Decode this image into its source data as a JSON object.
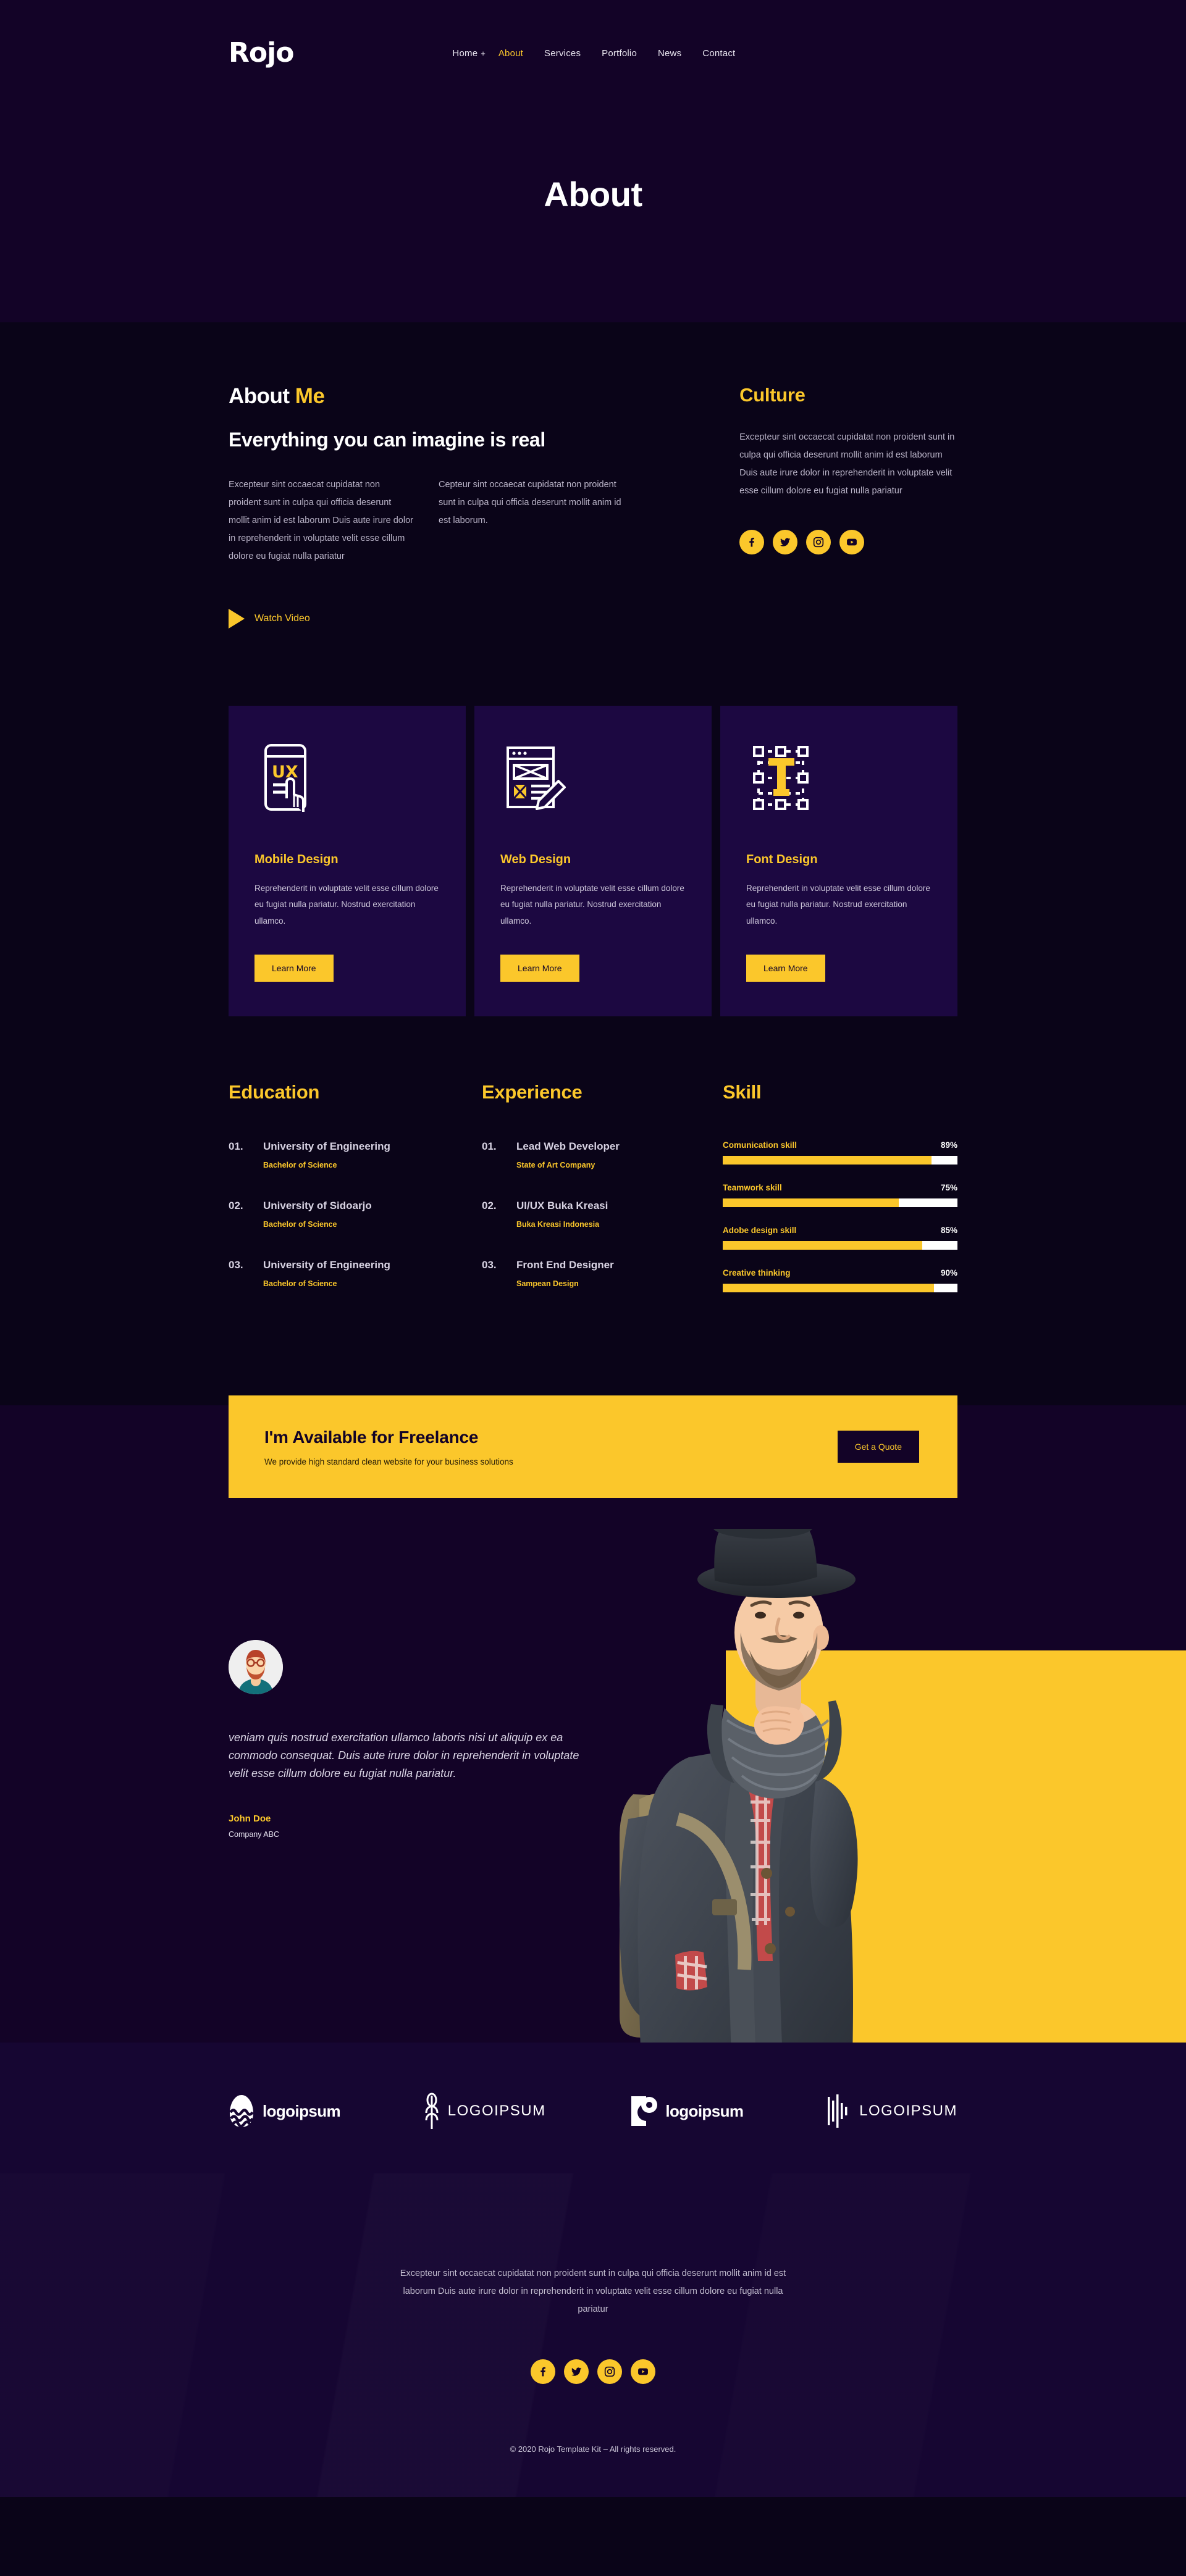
{
  "header": {
    "brand": "Rojo",
    "nav": [
      {
        "label": "Home",
        "active": false,
        "has_plus": true
      },
      {
        "label": "About",
        "active": true,
        "has_plus": false
      },
      {
        "label": "Services",
        "active": false,
        "has_plus": false
      },
      {
        "label": "Portfolio",
        "active": false,
        "has_plus": false
      },
      {
        "label": "News",
        "active": false,
        "has_plus": false
      },
      {
        "label": "Contact",
        "active": false,
        "has_plus": false
      }
    ]
  },
  "hero": {
    "title": "About"
  },
  "about": {
    "kicker_white": "About ",
    "kicker_accent": "Me",
    "heading": "Everything you can imagine is real",
    "paragraph_1": "Excepteur sint occaecat cupidatat non proident sunt in culpa qui officia deserunt mollit anim id est laborum Duis aute irure dolor in reprehenderit in voluptate velit esse cillum dolore eu fugiat nulla pariatur",
    "paragraph_2": "Cepteur sint occaecat cupidatat non proident sunt in culpa qui officia deserunt mollit anim id est laborum.",
    "watch_video_label": "Watch Video"
  },
  "culture": {
    "title": "Culture",
    "body": "Excepteur sint occaecat cupidatat non proident sunt in culpa qui officia deserunt mollit anim id est laborum Duis aute irure dolor in reprehenderit in voluptate velit esse cillum dolore eu fugiat nulla pariatur",
    "socials": [
      "facebook",
      "twitter",
      "instagram",
      "youtube"
    ]
  },
  "services": [
    {
      "icon": "mobile-ux-icon",
      "title": "Mobile Design",
      "body": "Reprehenderit in voluptate velit esse cillum dolore eu fugiat nulla pariatur. Nostrud exercitation ullamco.",
      "button": "Learn More"
    },
    {
      "icon": "wireframe-pencil-icon",
      "title": "Web Design",
      "body": "Reprehenderit in voluptate velit esse cillum dolore eu fugiat nulla pariatur. Nostrud exercitation ullamco.",
      "button": "Learn More"
    },
    {
      "icon": "typography-t-icon",
      "title": "Font Design",
      "body": "Reprehenderit in voluptate velit esse cillum dolore eu fugiat nulla pariatur. Nostrud exercitation ullamco.",
      "button": "Learn More"
    }
  ],
  "education": {
    "title": "Education",
    "items": [
      {
        "num": "01.",
        "title": "University of Engineering",
        "sub": "Bachelor of Science"
      },
      {
        "num": "02.",
        "title": "University of Sidoarjo",
        "sub": "Bachelor of Science"
      },
      {
        "num": "03.",
        "title": "University of Engineering",
        "sub": "Bachelor of Science"
      }
    ]
  },
  "experience": {
    "title": "Experience",
    "items": [
      {
        "num": "01.",
        "title": "Lead Web Developer",
        "sub": "State of Art Company"
      },
      {
        "num": "02.",
        "title": "UI/UX Buka Kreasi",
        "sub": "Buka Kreasi Indonesia"
      },
      {
        "num": "03.",
        "title": "Front End Designer",
        "sub": "Sampean Design"
      }
    ]
  },
  "skill": {
    "title": "Skill",
    "items": [
      {
        "name": "Comunication skill",
        "pct_label": "89%",
        "pct": 89
      },
      {
        "name": "Teamwork skill",
        "pct_label": "75%",
        "pct": 75
      },
      {
        "name": "Adobe design skill",
        "pct_label": "85%",
        "pct": 85
      },
      {
        "name": "Creative thinking",
        "pct_label": "90%",
        "pct": 90
      }
    ]
  },
  "cta": {
    "heading": "I'm Available for Freelance",
    "subheading": "We provide high standard clean website for your business solutions",
    "button": "Get a Quote"
  },
  "testimonial": {
    "quote": "veniam quis nostrud exercitation ullamco laboris nisi ut aliquip ex ea commodo consequat. Duis aute irure dolor in reprehenderit in voluptate velit esse cillum dolore eu fugiat nulla pariatur.",
    "name": "John Doe",
    "company": "Company ABC"
  },
  "logos": [
    {
      "name": "logoipsum-egg",
      "word": "logoipsum",
      "style": "bold"
    },
    {
      "name": "logoipsum-wheat",
      "word": "LOGOIPSUM",
      "style": "spaced"
    },
    {
      "name": "logoipsum-pin",
      "word": "logoipsum",
      "style": "bold"
    },
    {
      "name": "logoipsum-bars",
      "word": "LOGOIPSUM",
      "style": "spaced"
    }
  ],
  "footer": {
    "body": "Excepteur sint occaecat cupidatat non proident sunt in culpa qui officia deserunt mollit anim id est laborum Duis aute irure dolor in reprehenderit in voluptate velit esse cillum dolore eu fugiat nulla pariatur",
    "socials": [
      "facebook",
      "twitter",
      "instagram",
      "youtube"
    ],
    "copyright": "© 2020 Rojo Template Kit – All rights reserved."
  },
  "colors": {
    "accent": "#FBC72B",
    "bg_dark": "#0A0418",
    "bg_header": "#130327",
    "card_bg": "#1C0841"
  }
}
